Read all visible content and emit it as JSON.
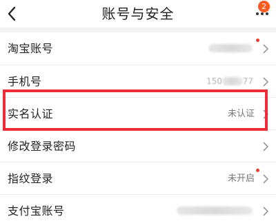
{
  "header": {
    "title": "账号与安全",
    "badge_count": "2",
    "back_icon": "chevron-left-icon",
    "more_icon": "more-dots-icon"
  },
  "rows": [
    {
      "label": "淘宝账号",
      "value": "",
      "redacted": true,
      "has_red_dot": true
    },
    {
      "label": "手机号",
      "value": "",
      "phone_prefix": "150",
      "phone_suffix": "77",
      "redacted": true
    },
    {
      "label": "实名认证",
      "value": "未认证",
      "highlighted": true
    },
    {
      "label": "修改登录密码",
      "value": ""
    },
    {
      "label": "指纹登录",
      "value": "未开启",
      "has_red_dot": true
    },
    {
      "label": "支付宝账号",
      "value": "",
      "redacted": true
    }
  ],
  "colors": {
    "highlight_border": "#ee2b36",
    "badge": "#ff5a1f",
    "red_dot": "#f0392b"
  }
}
